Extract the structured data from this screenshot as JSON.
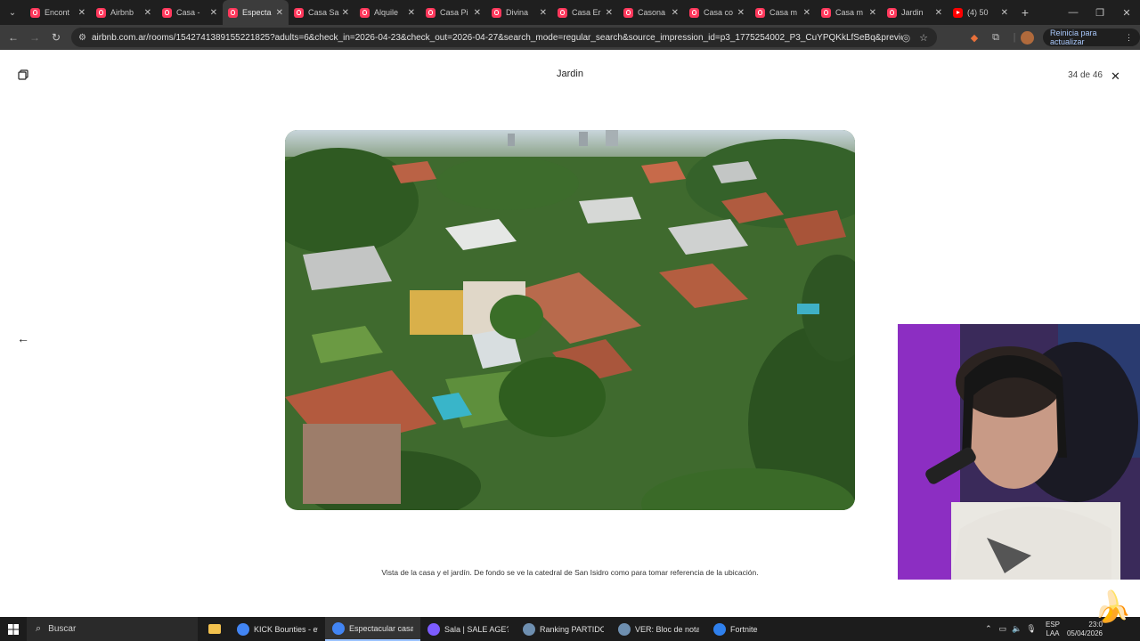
{
  "browser": {
    "tabs": [
      {
        "label": "Encont",
        "icon": "airbnb-icon",
        "active": false
      },
      {
        "label": "Airbnb",
        "icon": "airbnb-icon",
        "active": false
      },
      {
        "label": "Casa -",
        "icon": "airbnb-icon",
        "active": false
      },
      {
        "label": "Especta",
        "icon": "airbnb-icon",
        "active": true
      },
      {
        "label": "Casa Sa",
        "icon": "airbnb-icon",
        "active": false
      },
      {
        "label": "Alquile",
        "icon": "airbnb-icon",
        "active": false
      },
      {
        "label": "Casa Pi",
        "icon": "airbnb-icon",
        "active": false
      },
      {
        "label": "Divina",
        "icon": "airbnb-icon",
        "active": false
      },
      {
        "label": "Casa Er",
        "icon": "airbnb-icon",
        "active": false
      },
      {
        "label": "Casona",
        "icon": "airbnb-icon",
        "active": false
      },
      {
        "label": "Casa co",
        "icon": "airbnb-icon",
        "active": false
      },
      {
        "label": "Casa m",
        "icon": "airbnb-icon",
        "active": false
      },
      {
        "label": "Casa m",
        "icon": "airbnb-icon",
        "active": false
      },
      {
        "label": "Jardin",
        "icon": "airbnb-icon",
        "active": false
      },
      {
        "label": "(4) 50",
        "icon": "youtube-icon",
        "active": false
      }
    ],
    "url": "airbnb.com.ar/rooms/1542741389155221825?adults=6&check_in=2026-04-23&check_out=2026-04-27&search_mode=regular_search&source_impression_id=p3_1775254002_P3_CuYPQKkLfSeBq&previous_page_section_n...",
    "update_button": "Reinicia para actualizar"
  },
  "gallery": {
    "title": "Jardin",
    "counter": "34 de 46",
    "caption": "Vista de la casa y el jardín. De fondo se ve la catedral de San Isidro como para tomar referencia de la ubicación."
  },
  "taskbar": {
    "search_label": "Buscar",
    "items": [
      {
        "label": "KICK Bounties - eve...",
        "color": "#4285f4",
        "active": false
      },
      {
        "label": "Espectacular casa c...",
        "color": "#4285f4",
        "active": true
      },
      {
        "label": "Sala | SALE AGE? - ...",
        "color": "#7c5cff",
        "active": false
      },
      {
        "label": "Ranking PARTIDOS ...",
        "color": "#6e8fb0",
        "active": false
      },
      {
        "label": "VER: Bloc de notas",
        "color": "#6e8fb0",
        "active": false
      },
      {
        "label": "Fortnite",
        "color": "#2f80ed",
        "active": false
      }
    ],
    "lang_top": "ESP",
    "lang_bottom": "LAA",
    "time": "23:0",
    "date": "05/04/2026"
  },
  "colors": {
    "airbnb": "#ff385c",
    "tab_strip": "#1f1f1f",
    "toolbar": "#3c3c3c",
    "taskbar": "#1c1c1c"
  }
}
